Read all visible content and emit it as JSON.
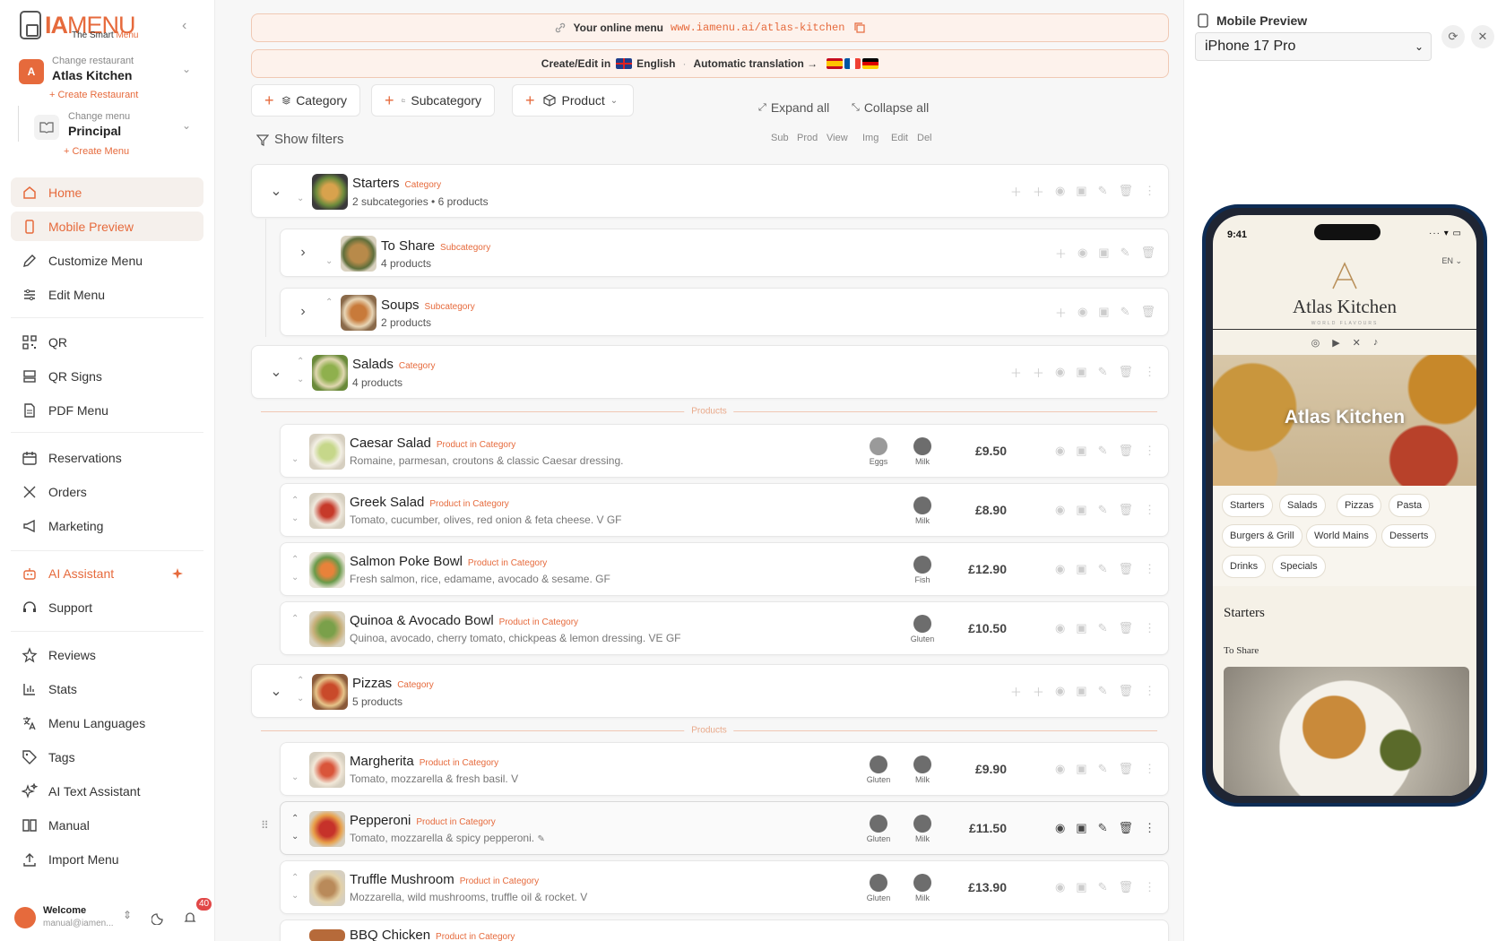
{
  "brand": {
    "ia": "IA",
    "menu": "MENU",
    "tagline_a": "The Smart ",
    "tagline_b": "Menu"
  },
  "restaurant": {
    "change_label": "Change restaurant",
    "name": "Atlas Kitchen",
    "avatar_letter": "A",
    "create_link": "+ Create Restaurant"
  },
  "menu_sel": {
    "change_label": "Change menu",
    "name": "Principal",
    "create_link": "+ Create Menu"
  },
  "nav": [
    {
      "label": "Home",
      "icon": "home-icon"
    },
    {
      "label": "Mobile Preview",
      "icon": "phone-icon"
    },
    {
      "label": "Customize Menu",
      "icon": "brush-icon"
    },
    {
      "label": "Edit Menu",
      "icon": "sliders-icon"
    },
    {
      "label": "QR",
      "icon": "qr-icon"
    },
    {
      "label": "QR Signs",
      "icon": "sign-icon"
    },
    {
      "label": "PDF Menu",
      "icon": "file-icon"
    },
    {
      "label": "Reservations",
      "icon": "calendar-icon"
    },
    {
      "label": "Orders",
      "icon": "utensils-icon"
    },
    {
      "label": "Marketing",
      "icon": "megaphone-icon"
    },
    {
      "label": "AI Assistant",
      "icon": "robot-icon"
    },
    {
      "label": "Support",
      "icon": "headset-icon"
    },
    {
      "label": "Reviews",
      "icon": "star-icon"
    },
    {
      "label": "Stats",
      "icon": "chart-icon"
    },
    {
      "label": "Menu Languages",
      "icon": "translate-icon"
    },
    {
      "label": "Tags",
      "icon": "tag-icon"
    },
    {
      "label": "AI Text Assistant",
      "icon": "sparkles-icon"
    },
    {
      "label": "Manual",
      "icon": "book-icon"
    },
    {
      "label": "Import Menu",
      "icon": "upload-icon"
    }
  ],
  "user": {
    "welcome": "Welcome",
    "email": "manual@iamen...",
    "notifications": "40"
  },
  "banner": {
    "online_label": "Your online menu",
    "url": "www.iamenu.ai/atlas-kitchen",
    "edit_label": "Create/Edit in",
    "language": "English",
    "auto_label": "Automatic translation →"
  },
  "toolbar": {
    "category": "Category",
    "subcategory": "Subcategory",
    "product": "Product",
    "expand": "Expand all",
    "collapse": "Collapse all",
    "filters": "Show filters"
  },
  "columns": [
    "Sub",
    "Prod",
    "View",
    "Img",
    "Edit",
    "Del"
  ],
  "rows": {
    "starters": {
      "title": "Starters",
      "tag": "Category",
      "sub": "2 subcategories • 6 products"
    },
    "to_share": {
      "title": "To Share",
      "tag": "Subcategory",
      "sub": "4 products"
    },
    "soups": {
      "title": "Soups",
      "tag": "Subcategory",
      "sub": "2 products"
    },
    "salads": {
      "title": "Salads",
      "tag": "Category",
      "sub": "4 products"
    },
    "pizzas": {
      "title": "Pizzas",
      "tag": "Category",
      "sub": "5 products"
    }
  },
  "products_divider": "Products",
  "products": {
    "caesar": {
      "title": "Caesar Salad",
      "tag": "Product in Category",
      "desc": "Romaine, parmesan, croutons & classic Caesar dressing.",
      "price": "£9.50",
      "a1": "Eggs",
      "a2": "Milk"
    },
    "greek": {
      "title": "Greek Salad",
      "tag": "Product in Category",
      "desc": "Tomato, cucumber, olives, red onion & feta cheese. V GF",
      "price": "£8.90",
      "a2": "Milk"
    },
    "poke": {
      "title": "Salmon Poke Bowl",
      "tag": "Product in Category",
      "desc": "Fresh salmon, rice, edamame, avocado & sesame. GF",
      "price": "£12.90",
      "a2": "Fish"
    },
    "quinoa": {
      "title": "Quinoa & Avocado Bowl",
      "tag": "Product in Category",
      "desc": "Quinoa, avocado, cherry tomato, chickpeas & lemon dressing. VE GF",
      "price": "£10.50",
      "a2": "Gluten"
    },
    "margherita": {
      "title": "Margherita",
      "tag": "Product in Category",
      "desc": "Tomato, mozzarella & fresh basil. V",
      "price": "£9.90",
      "a1": "Gluten",
      "a2": "Milk"
    },
    "pepperoni": {
      "title": "Pepperoni",
      "tag": "Product in Category",
      "desc": "Tomato, mozzarella & spicy pepperoni.",
      "price": "£11.50",
      "a1": "Gluten",
      "a2": "Milk"
    },
    "truffle": {
      "title": "Truffle Mushroom",
      "tag": "Product in Category",
      "desc": "Mozzarella, wild mushrooms, truffle oil & rocket. V",
      "price": "£13.90",
      "a1": "Gluten",
      "a2": "Milk"
    },
    "bbq": {
      "title": "BBQ Chicken",
      "tag": "Product in Category"
    }
  },
  "preview": {
    "title": "Mobile Preview",
    "device": "iPhone 17 Pro",
    "time": "9:41",
    "lang": "EN",
    "restaurant_name": "Atlas Kitchen",
    "restaurant_tagline": "WORLD FLAVOURS",
    "hero_title": "Atlas Kitchen",
    "categories": [
      "Starters",
      "Salads",
      "Pizzas",
      "Pasta",
      "Burgers & Grill",
      "World Mains",
      "Desserts",
      "Drinks",
      "Specials"
    ],
    "section": "Starters",
    "subsection": "To Share"
  },
  "colors": {
    "accent": "#e66a3c",
    "active_bg": "#f5f0ec",
    "banner_bg": "#fdf2ec"
  }
}
